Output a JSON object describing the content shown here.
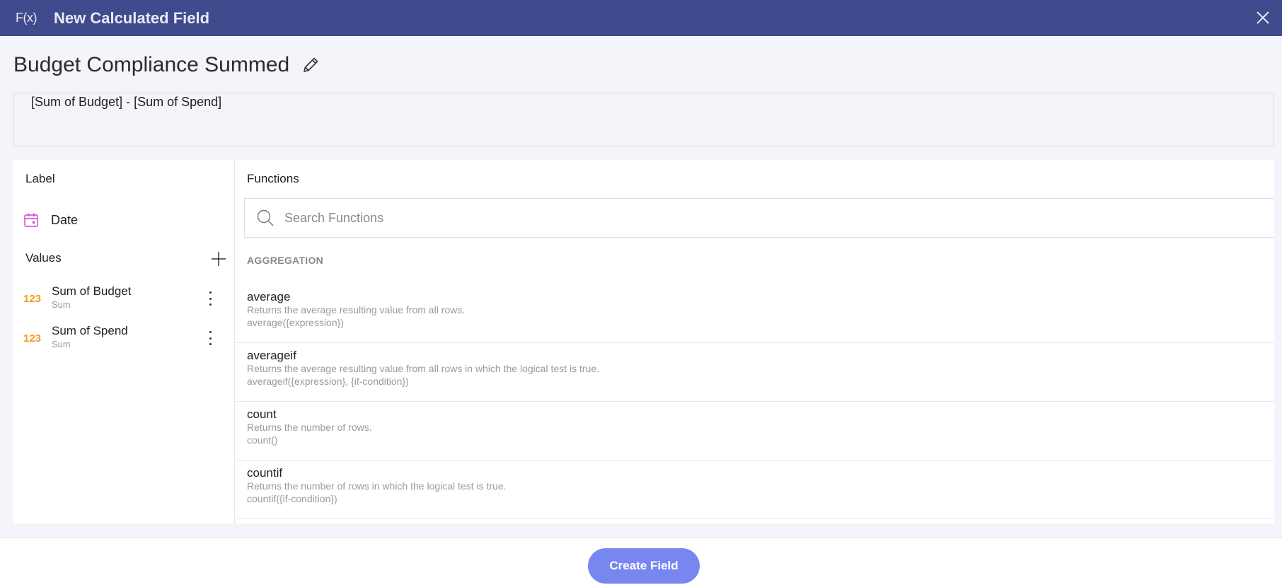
{
  "dialog": {
    "fx_label": "F(x)",
    "title": "New Calculated Field"
  },
  "field": {
    "name": "Budget Compliance Summed",
    "expression": "[Sum of Budget] - [Sum of Spend]"
  },
  "label_section": {
    "title": "Label",
    "item": {
      "name": "Date",
      "icon": "calendar-icon",
      "icon_color": "#d63fd3"
    }
  },
  "values_section": {
    "title": "Values",
    "items": [
      {
        "type_badge": "123",
        "name": "Sum of Budget",
        "aggregation": "Sum"
      },
      {
        "type_badge": "123",
        "name": "Sum of Spend",
        "aggregation": "Sum"
      }
    ],
    "badge_color": "#f59a1a"
  },
  "functions": {
    "title": "Functions",
    "search_placeholder": "Search Functions",
    "category": "AGGREGATION",
    "items": [
      {
        "name": "average",
        "description": "Returns the average resulting value from all rows.",
        "signature": "average({expression})"
      },
      {
        "name": "averageif",
        "description": "Returns the average resulting value from all rows in which the logical test is true.",
        "signature": "averageif({expression}, {if-condition})"
      },
      {
        "name": "count",
        "description": "Returns the number of rows.",
        "signature": "count()"
      },
      {
        "name": "countif",
        "description": "Returns the number of rows in which the logical test is true.",
        "signature": "countif({if-condition})"
      }
    ]
  },
  "footer": {
    "create_label": "Create Field"
  },
  "colors": {
    "titlebar": "#3f4b8c",
    "primary_button": "#7887f0"
  }
}
